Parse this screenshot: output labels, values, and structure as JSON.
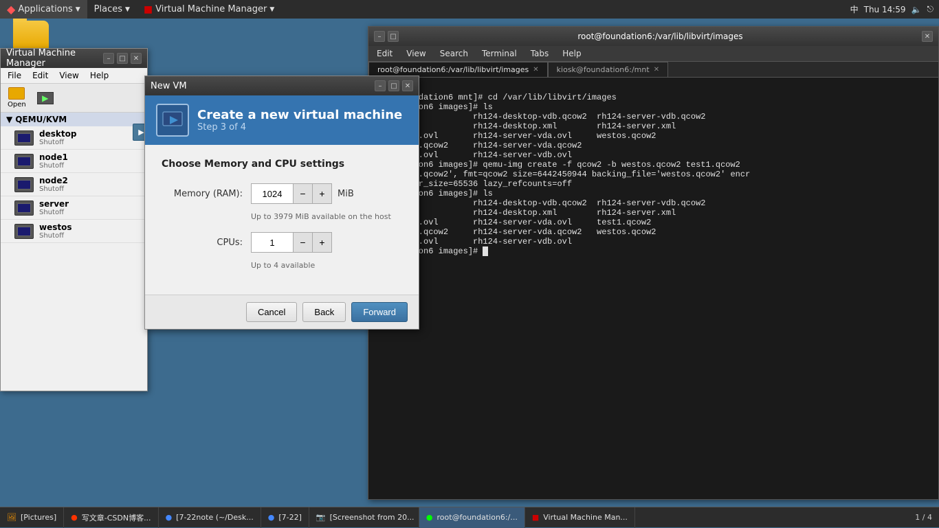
{
  "topbar": {
    "applications_label": "Applications",
    "places_label": "Places",
    "vmm_label": "Virtual Machine Manager",
    "time": "Thu 14:59",
    "input_method": "中"
  },
  "vmm_window": {
    "title": "Virtual Machine Manager",
    "menus": [
      "File",
      "Edit",
      "View",
      "Help"
    ],
    "toolbar": {
      "open_label": "Open",
      "run_label": ""
    },
    "group": "QEMU/KVM",
    "vms": [
      {
        "name": "desktop",
        "status": "Shutoff"
      },
      {
        "name": "node1",
        "status": "Shutoff"
      },
      {
        "name": "node2",
        "status": "Shutoff"
      },
      {
        "name": "server",
        "status": "Shutoff"
      },
      {
        "name": "westos",
        "status": "Shutoff"
      }
    ]
  },
  "newvm_dialog": {
    "title": "New VM",
    "header_title": "Create a new virtual machine",
    "header_step": "Step 3 of 4",
    "section_title": "Choose Memory and CPU settings",
    "memory_label": "Memory (RAM):",
    "memory_value": "1024",
    "memory_unit": "MiB",
    "memory_hint": "Up to 3979 MiB available on the host",
    "cpu_label": "CPUs:",
    "cpu_value": "1",
    "cpu_hint": "Up to 4 available",
    "cancel_label": "Cancel",
    "back_label": "Back",
    "forward_label": "Forward"
  },
  "terminal": {
    "title": "root@foundation6:/var/lib/libvirt/images",
    "menus": [
      "Edit",
      "View",
      "Search",
      "Terminal",
      "Tabs",
      "Help"
    ],
    "tabs": [
      {
        "label": "root@foundation6:/var/lib/libvirt/images",
        "active": true
      },
      {
        "label": "kiosk@foundation6:/mnt",
        "active": false
      }
    ],
    "content": "[foundation6 mnt]# cd /var/lib/libvirt/images\n[foundation6 images]# ls\now2                 rh124-desktop-vdb.qcow2  rh124-server-vdb.qcow2\now2                 rh124-desktop.xml        rh124-server.xml\nsktop-vda.ovl       rh124-server-vda.ovl     westos.qcow2\nsktop-vda.qcow2     rh124-server-vda.qcow2\nsktop-vdb.ovl       rh124-server-vdb.ovl\n[foundation6 images]# qemu-img create -f qcow2 -b westos.qcow2 test1.qcow2\nng 'test1.qcow2', fmt=qcow2 size=6442450944 backing_file='westos.qcow2' encr\nff cluster_size=65536 lazy_refcounts=off\n[foundation6 images]# ls\now2                 rh124-desktop-vdb.qcow2  rh124-server-vdb.qcow2\now2                 rh124-desktop.xml        rh124-server.xml\nsktop-vda.ovl       rh124-server-vda.ovl     test1.qcow2\nsktop-vda.qcow2     rh124-server-vda.qcow2   westos.qcow2\nsktop-vdb.ovl       rh124-server-vdb.ovl\n[foundation6 images]# "
  },
  "taskbar": {
    "items": [
      {
        "label": "[Pictures]",
        "active": false
      },
      {
        "label": "写文章-CSDN博客...",
        "active": false
      },
      {
        "label": "[7-22note (~/Desk...",
        "active": false
      },
      {
        "label": "[7-22]",
        "active": false
      },
      {
        "label": "[Screenshot from 20...",
        "active": false
      },
      {
        "label": "root@foundation6:/...",
        "active": true
      },
      {
        "label": "Virtual Machine Man...",
        "active": false
      }
    ],
    "page_indicator": "1 / 4"
  }
}
